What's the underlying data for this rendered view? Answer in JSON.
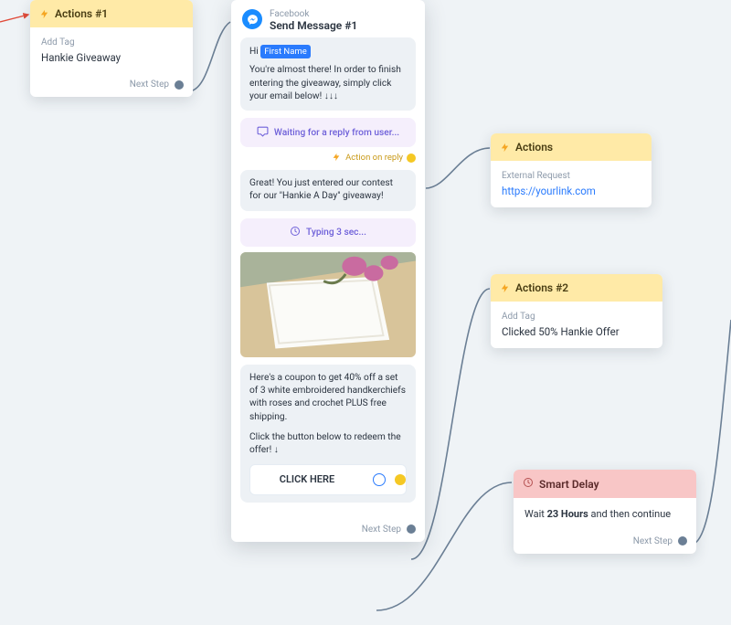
{
  "labels": {
    "next_step": "Next Step",
    "action_on_reply": "Action on reply"
  },
  "actions1": {
    "title": "Actions #1",
    "body_label": "Add Tag",
    "body_value": "Hankie Giveaway"
  },
  "send_message": {
    "platform": "Facebook",
    "title": "Send Message #1",
    "bubble1_greeting": "Hi ",
    "bubble1_pill": "First Name",
    "bubble1_body": "You're almost there! In order to finish entering the giveaway, simply click your email below! ↓↓↓",
    "waiting": "Waiting for a reply from user...",
    "bubble2": "Great! You just entered our contest for our \"Hankie A Day\" giveaway!",
    "typing": "Typing 3 sec...",
    "bubble3_p1": "Here's a coupon to get 40% off a set of 3 white embroidered handkerchiefs with roses and crochet PLUS free shipping.",
    "bubble3_p2": "Click the button below to redeem the offer! ↓",
    "cta": "CLICK HERE"
  },
  "actions": {
    "title": "Actions",
    "body_label": "External Request",
    "body_value": "https://yourlink.com"
  },
  "actions2": {
    "title": "Actions #2",
    "body_label": "Add Tag",
    "body_value": "Clicked 50% Hankie Offer"
  },
  "smart_delay": {
    "title": "Smart Delay",
    "body_prefix": "Wait ",
    "body_bold": "23 Hours",
    "body_suffix": " and then continue"
  }
}
